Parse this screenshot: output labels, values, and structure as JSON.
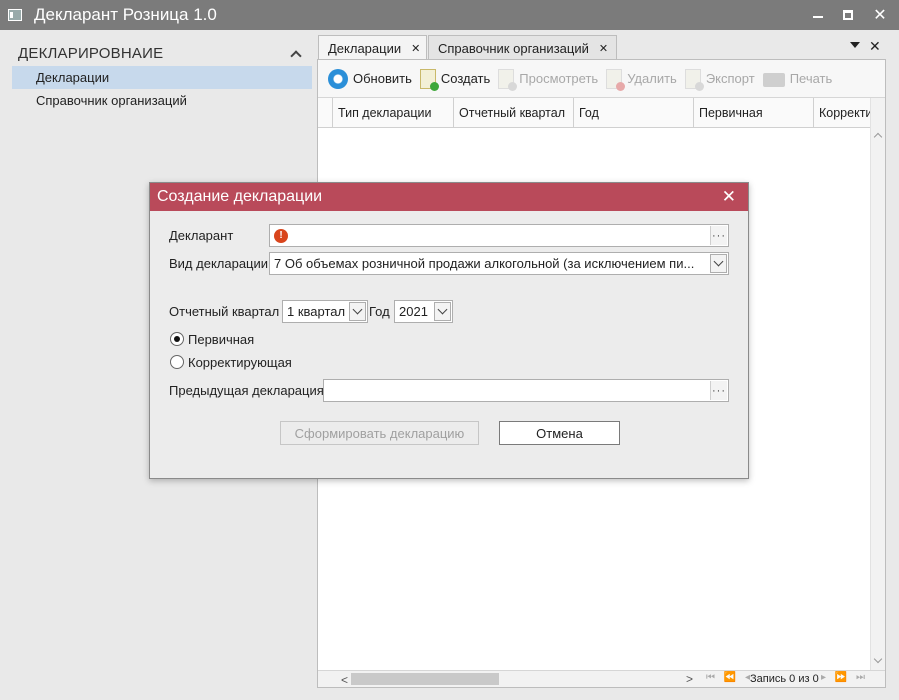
{
  "window": {
    "title": "Декларант Розница 1.0",
    "controls": {
      "minimize": "minimize-icon",
      "maximize": "maximize-icon",
      "close": "✕"
    }
  },
  "nav": {
    "section_title": "ДЕКЛАРИРОВНАИЕ",
    "items": [
      {
        "label": "Декларации",
        "active": true
      },
      {
        "label": "Справочник организаций",
        "active": false
      }
    ]
  },
  "tabs": [
    {
      "label": "Декларации",
      "close": "✕",
      "active": true
    },
    {
      "label": "Справочник организаций",
      "close": "✕",
      "active": false
    }
  ],
  "tabs_close_all": "✕",
  "toolbar": {
    "refresh": "Обновить",
    "create": "Создать",
    "view": "Просмотреть",
    "delete": "Удалить",
    "export": "Экспорт",
    "print": "Печать"
  },
  "grid": {
    "columns": [
      "Тип декларации",
      "Отчетный квартал",
      "Год",
      "Первичная",
      "Корректи"
    ],
    "rows": []
  },
  "footer": {
    "scroll_left": "<",
    "scroll_right": ">",
    "pager_prev": "⏮ ⏪ ◂",
    "record_status": "Запись 0 из 0",
    "pager_next": "▸ ⏩ ⏭"
  },
  "dialog": {
    "title": "Создание декларации",
    "close": "✕",
    "declarant_label": "Декларант",
    "declarant_value": "",
    "warning_glyph": "!",
    "dots": "···",
    "type_label": "Вид декларации",
    "type_value": "7 Об объемах розничной продажи алкогольной (за исключением пи...",
    "quarter_label": "Отчетный квартал",
    "quarter_value": "1 квартал",
    "year_label": "Год",
    "year_value": "2021",
    "primary_label": "Первичная",
    "corrective_label": "Корректирующая",
    "selected": "primary",
    "prev_decl_label": "Предыдущая декларация",
    "prev_decl_value": "",
    "generate_button": "Сформировать декларацию",
    "cancel_button": "Отмена"
  },
  "colors": {
    "titlebar": "#7b7b7b",
    "dialog_title": "#b94a5a",
    "nav_active": "#c7d9ec",
    "warning": "#d9451c"
  }
}
